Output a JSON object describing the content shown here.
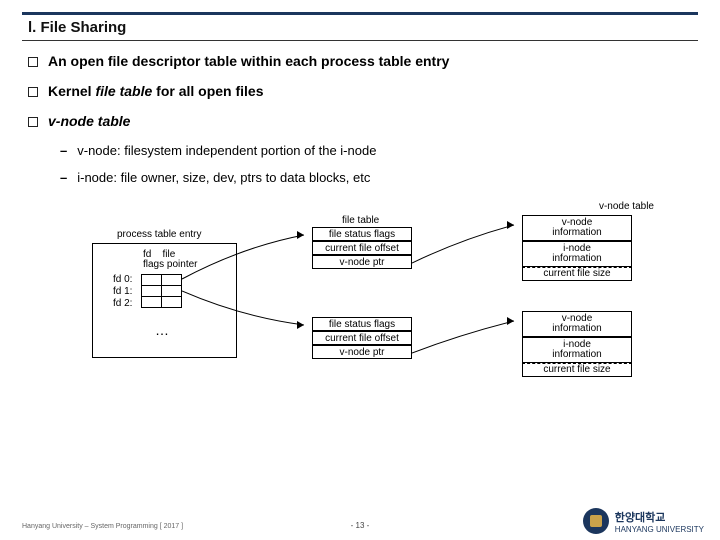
{
  "title": "l.  File Sharing",
  "bullets": {
    "b1": "An open file descriptor table within each process table entry",
    "b2_pre": "Kernel ",
    "b2_em": "file table",
    "b2_post": " for all open files",
    "b3": "v-node table"
  },
  "subs": {
    "s1": "v-node: filesystem independent portion of the i-node",
    "s2": "i-node: file owner, size, dev, ptrs to data blocks, etc"
  },
  "diagram": {
    "vnode_table_label": "v-node table",
    "file_table_label": "file table",
    "process_table_label": "process table entry",
    "col_fd": "fd",
    "col_flags": "flags",
    "col_file": "file",
    "col_pointer": "pointer",
    "fd0": "fd 0:",
    "fd1": "fd 1:",
    "fd2": "fd 2:",
    "ellipsis": "…",
    "file_status_flags": "file status flags",
    "current_file_offset": "current file offset",
    "vnode_ptr": "v-node ptr",
    "vnode_info": "v-node",
    "information": "information",
    "inode_info": "i-node",
    "current_file_size": "current file size"
  },
  "footer": {
    "left": "Hanyang University – System Programming  [ 2017 ]",
    "center": "- 13 -",
    "logo_kr": "한양대학교",
    "logo_en": "HANYANG UNIVERSITY"
  }
}
